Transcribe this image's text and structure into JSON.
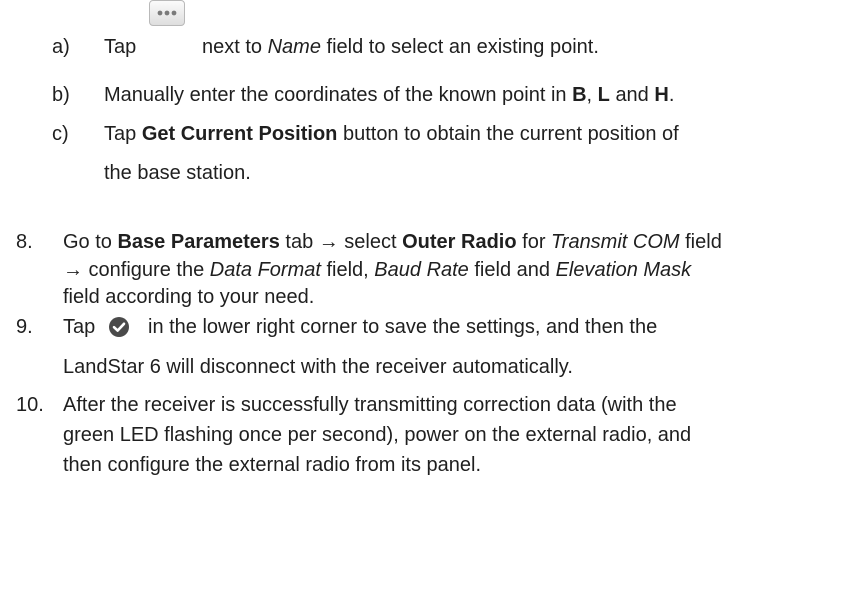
{
  "steps_a_c": [
    {
      "marker": "a)",
      "parts": {
        "t1": "Tap",
        "t2": "next to",
        "t3": "Name",
        "t4": "field to select an existing point."
      }
    },
    {
      "marker": "b)",
      "parts": {
        "t1": "Manually enter the coordinates of the known point in",
        "t2": "B",
        "t3": ",",
        "t4": "L",
        "t5": "and",
        "t6": "H",
        "t7": "."
      }
    },
    {
      "marker": "c)",
      "parts": {
        "t1": "Tap",
        "t2": "Get Current Position",
        "t3": "button to obtain the current position of",
        "t4": "the base station."
      }
    }
  ],
  "step8": {
    "marker": "8.",
    "line1": {
      "a": "Go to",
      "b": "Base Parameters",
      "c": "tab → select",
      "d": "Outer Radio",
      "e": "for",
      "f": "Transmit COM",
      "g": "field"
    },
    "line2": {
      "a": "→ configure the",
      "b": "Data Format",
      "c": "field,",
      "d": "Baud Rate",
      "e": "field and",
      "f": "Elevation Mask"
    },
    "line3": "field according to your need."
  },
  "step9": {
    "marker": "9.",
    "line1a": "Tap",
    "line1b": "in the lower right corner to save the settings, and then the",
    "line2": "LandStar 6 will disconnect with the receiver automatically."
  },
  "step10": {
    "marker": "10.",
    "line1": "After the receiver is successfully transmitting correction data (with the",
    "line2": "green LED flashing once per second), power on the external radio, and",
    "line3": "then configure the external radio from its panel."
  },
  "icons": {
    "more": "more-dots-icon",
    "confirm": "checkmark-circle-icon"
  },
  "colors": {
    "text": "#1f1f1f",
    "check": "#4a4a4a"
  }
}
